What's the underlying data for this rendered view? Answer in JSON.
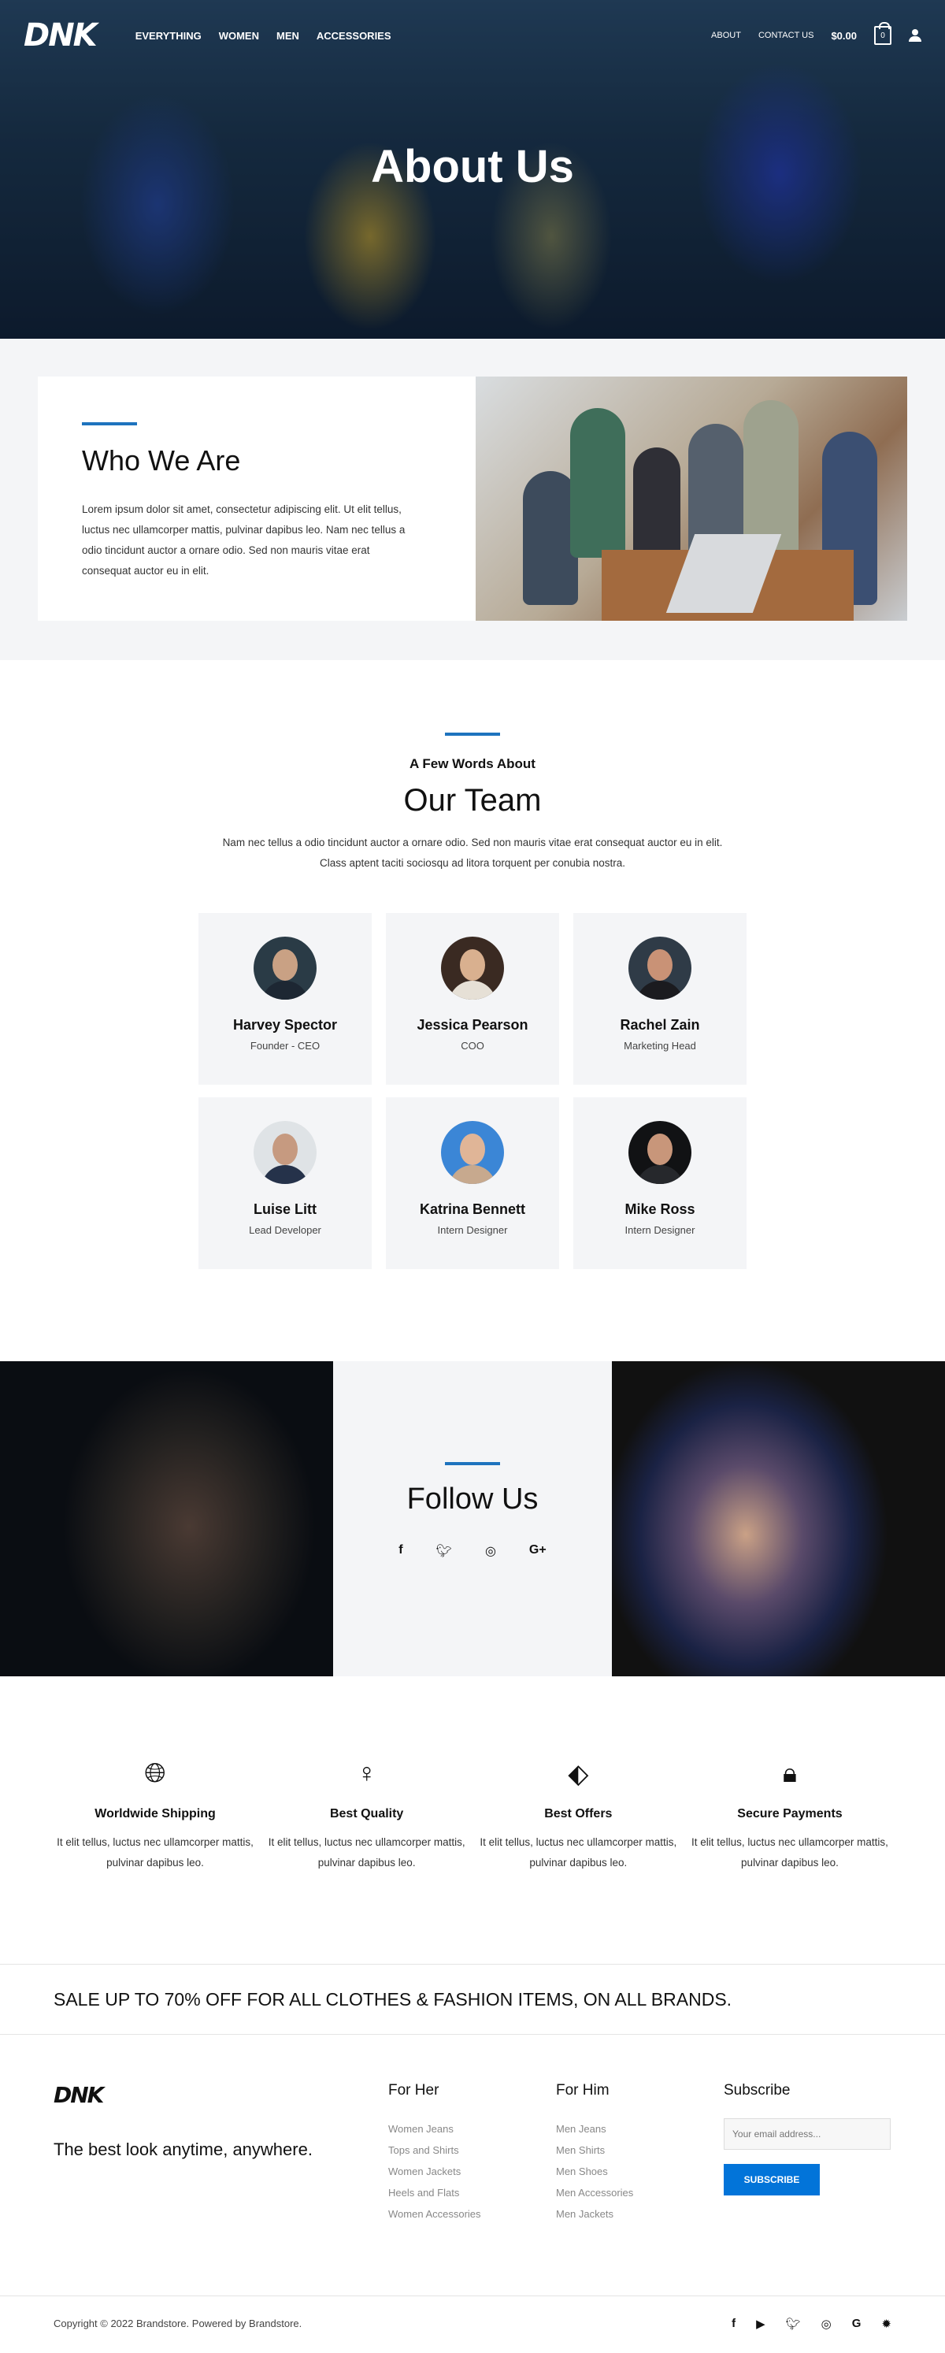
{
  "nav": {
    "logo": "DNK",
    "menu": [
      "EVERYTHING",
      "WOMEN",
      "MEN",
      "ACCESSORIES"
    ],
    "right_links": [
      "ABOUT",
      "CONTACT US"
    ],
    "cart_total": "$0.00",
    "cart_count": "0"
  },
  "hero": {
    "title": "About Us"
  },
  "who": {
    "title": "Who We Are",
    "text": "Lorem ipsum dolor sit amet, consectetur adipiscing elit. Ut elit tellus, luctus nec ullamcorper mattis, pulvinar dapibus leo. Nam nec tellus a odio tincidunt auctor a ornare odio. Sed non mauris vitae erat consequat auctor eu in elit."
  },
  "team": {
    "subtitle": "A Few Words About",
    "title": "Our Team",
    "description_line1": "Nam nec tellus a odio tincidunt auctor a ornare odio. Sed non mauris vitae erat consequat auctor eu in elit.",
    "description_line2": "Class aptent taciti sociosqu ad litora torquent per conubia nostra.",
    "members": [
      {
        "name": "Harvey Spector",
        "role": "Founder - CEO"
      },
      {
        "name": "Jessica Pearson",
        "role": "COO"
      },
      {
        "name": "Rachel Zain",
        "role": "Marketing Head"
      },
      {
        "name": "Luise Litt",
        "role": "Lead Developer"
      },
      {
        "name": "Katrina Bennett",
        "role": "Intern Designer"
      },
      {
        "name": "Mike Ross",
        "role": "Intern Designer"
      }
    ]
  },
  "follow": {
    "title": "Follow Us",
    "icons": [
      "facebook-icon",
      "twitter-icon",
      "instagram-icon",
      "google-plus-icon"
    ]
  },
  "features": [
    {
      "icon": "globe-icon",
      "title": "Worldwide Shipping",
      "text": "It elit tellus, luctus nec ullamcorper mattis, pulvinar dapibus leo."
    },
    {
      "icon": "mannequin-icon",
      "title": "Best Quality",
      "text": "It elit tellus, luctus nec ullamcorper mattis, pulvinar dapibus leo."
    },
    {
      "icon": "price-tag-icon",
      "title": "Best Offers",
      "text": "It elit tellus, luctus nec ullamcorper mattis, pulvinar dapibus leo."
    },
    {
      "icon": "lock-icon",
      "title": "Secure Payments",
      "text": "It elit tellus, luctus nec ullamcorper mattis, pulvinar dapibus leo."
    }
  ],
  "sale": {
    "text": "SALE UP TO 70% OFF FOR ALL CLOTHES & FASHION ITEMS, ON ALL BRANDS."
  },
  "footer": {
    "logo": "DNK",
    "tagline": "The best look anytime, anywhere.",
    "for_her": {
      "title": "For Her",
      "links": [
        "Women Jeans",
        "Tops and Shirts",
        "Women Jackets",
        "Heels and Flats",
        "Women Accessories"
      ]
    },
    "for_him": {
      "title": "For Him",
      "links": [
        "Men Jeans",
        "Men Shirts",
        "Men Shoes",
        "Men Accessories",
        "Men Jackets"
      ]
    },
    "subscribe": {
      "title": "Subscribe",
      "placeholder": "Your email address...",
      "button": "SUBSCRIBE"
    },
    "copyright": "Copyright © 2022 Brandstore. Powered by Brandstore.",
    "social_icons": [
      "facebook-icon",
      "youtube-icon",
      "twitter-icon",
      "instagram-icon",
      "google-icon",
      "yelp-icon"
    ]
  },
  "colors": {
    "accent": "#1e73be",
    "button": "#0274d9",
    "section_bg": "#f4f5f7"
  }
}
